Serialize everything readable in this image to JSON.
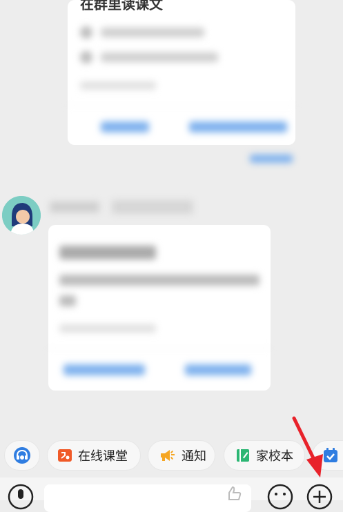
{
  "top_card": {
    "title_text": "在群里读课文"
  },
  "quick_actions": [
    {
      "label": "",
      "icon": "assistant-icon"
    },
    {
      "label": "在线课堂",
      "icon": "online-classroom-icon"
    },
    {
      "label": "通知",
      "icon": "notice-icon"
    },
    {
      "label": "家校本",
      "icon": "homework-book-icon"
    },
    {
      "label": "",
      "icon": "checkin-icon"
    }
  ],
  "colors": {
    "background": "#ededed",
    "accent_blue": "#2f7de1",
    "annotation_red": "#e8222a"
  }
}
